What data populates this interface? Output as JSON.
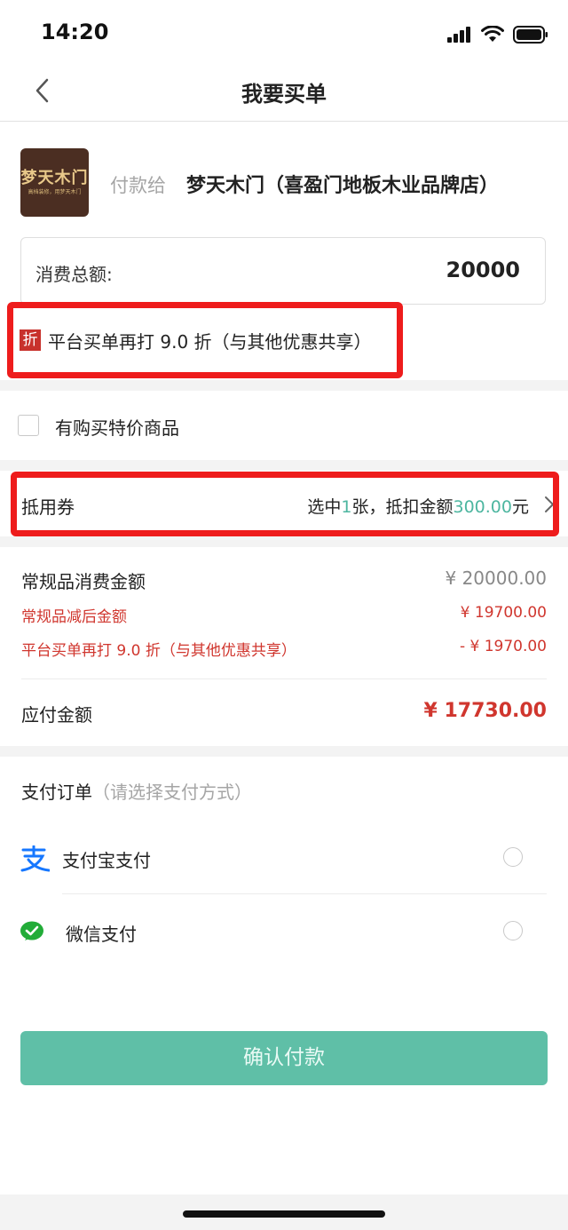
{
  "status": {
    "time": "14:20"
  },
  "nav": {
    "title": "我要买单"
  },
  "merchant": {
    "logo_text": "梦天木门",
    "logo_slogan": "高档装修，用梦天木门",
    "pay_to_label": "付款给",
    "name": "梦天木门（喜盈门地板木业品牌店）"
  },
  "amount": {
    "label": "消费总额:",
    "value": "20000"
  },
  "discount": {
    "tag": "折",
    "text": "平台买单再打 9.0 折（与其他优惠共享）"
  },
  "special": {
    "label": "有购买特价商品",
    "checked": false
  },
  "coupon": {
    "label": "抵用券",
    "prefix": "选中",
    "count": "1",
    "middle": "张，抵扣金额",
    "amount": "300.00",
    "suffix": "元"
  },
  "breakdown": {
    "regular_label": "常规品消费金额",
    "regular_value": "¥ 20000.00",
    "reduced_label": "常规品减后金额",
    "reduced_value": "¥ 19700.00",
    "platform_label": "平台买单再打 9.0 折（与其他优惠共享）",
    "platform_value": "- ¥ 1970.00",
    "due_label": "应付金额",
    "due_value": "¥ 17730.00"
  },
  "payment": {
    "title": "支付订单",
    "hint": "（请选择支付方式）",
    "methods": [
      {
        "label": "支付宝支付",
        "icon": "alipay-icon",
        "selected": false
      },
      {
        "label": "微信支付",
        "icon": "wechat-pay-icon",
        "selected": false
      }
    ]
  },
  "confirm_label": "确认付款",
  "colors": {
    "accent": "#5fbfa7",
    "teal_text": "#4db6a0",
    "red": "#d0362e",
    "highlight": "#ee1c1c"
  }
}
